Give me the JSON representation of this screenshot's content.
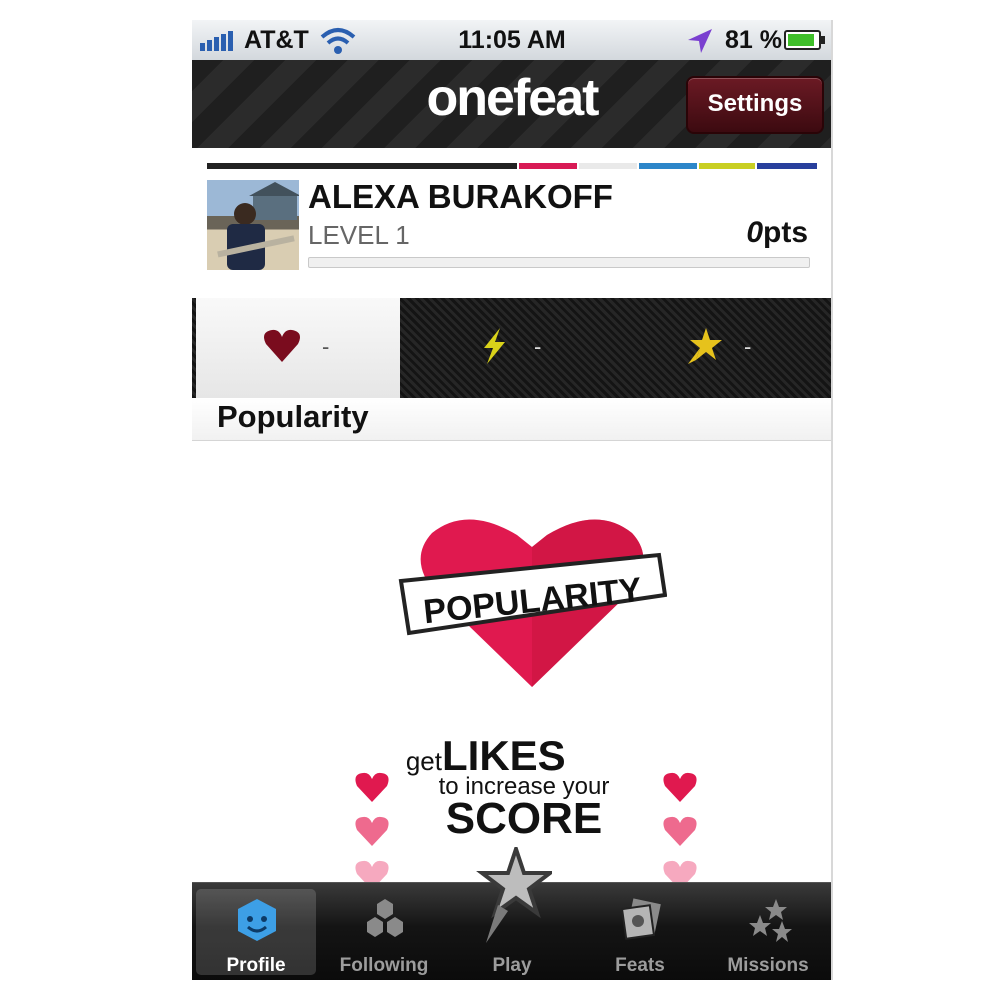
{
  "status_bar": {
    "carrier": "AT&T",
    "time": "11:05 AM",
    "battery": "81 %",
    "icons": [
      "signal-icon",
      "wifi-icon",
      "location-arrow-icon",
      "battery-icon"
    ]
  },
  "nav": {
    "logo": "onefeat",
    "settings_label": "Settings"
  },
  "profile": {
    "name": "ALEXA BURAKOFF",
    "level": "LEVEL 1",
    "points_value": "0",
    "points_unit": "pts",
    "progress_fraction": 0
  },
  "stats": [
    {
      "icon": "heart-icon",
      "value": "-",
      "color": "#7a0c1e"
    },
    {
      "icon": "lightning-icon",
      "value": "-",
      "color": "#d9d21a"
    },
    {
      "icon": "star-icon",
      "value": "-",
      "color": "#e6c21c"
    }
  ],
  "section": {
    "title": "Popularity"
  },
  "badge": {
    "banner_text": "POPULARITY",
    "heart_color": "#e0194f"
  },
  "tagline": {
    "get": "get",
    "likes": "LIKES",
    "middle": "to increase your",
    "score": "SCORE"
  },
  "tabs": [
    {
      "label": "Profile",
      "icon": "profile-icon",
      "active": true
    },
    {
      "label": "Following",
      "icon": "following-icon",
      "active": false
    },
    {
      "label": "Play",
      "icon": "play-star-icon",
      "active": false
    },
    {
      "label": "Feats",
      "icon": "feats-icon",
      "active": false
    },
    {
      "label": "Missions",
      "icon": "missions-icon",
      "active": false
    }
  ],
  "colors": {
    "accent": "#e0194f",
    "nav_dark": "#222222",
    "settings_button": "#5a1520"
  }
}
